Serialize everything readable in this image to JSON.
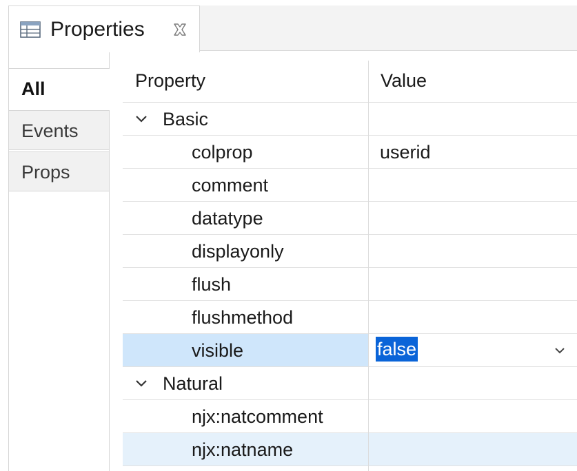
{
  "view": {
    "title": "Properties",
    "icon": "table-icon",
    "close_icon": "close-icon"
  },
  "categories": [
    {
      "label": "All",
      "active": true
    },
    {
      "label": "Events",
      "active": false
    },
    {
      "label": "Props",
      "active": false
    }
  ],
  "table": {
    "header_property": "Property",
    "header_value": "Value",
    "groups": [
      {
        "label": "Basic",
        "expanded": true,
        "rows": [
          {
            "name": "colprop",
            "value": "userid"
          },
          {
            "name": "comment",
            "value": ""
          },
          {
            "name": "datatype",
            "value": ""
          },
          {
            "name": "displayonly",
            "value": ""
          },
          {
            "name": "flush",
            "value": ""
          },
          {
            "name": "flushmethod",
            "value": ""
          },
          {
            "name": "visible",
            "value": "false",
            "editing": true
          }
        ]
      },
      {
        "label": "Natural",
        "expanded": true,
        "rows": [
          {
            "name": "njx:natcomment",
            "value": ""
          },
          {
            "name": "njx:natname",
            "value": ""
          }
        ]
      }
    ]
  },
  "colors": {
    "selection_row": "#cfe6fb",
    "hover_row": "#e5f1fb",
    "text_selection": "#0a64d8"
  }
}
